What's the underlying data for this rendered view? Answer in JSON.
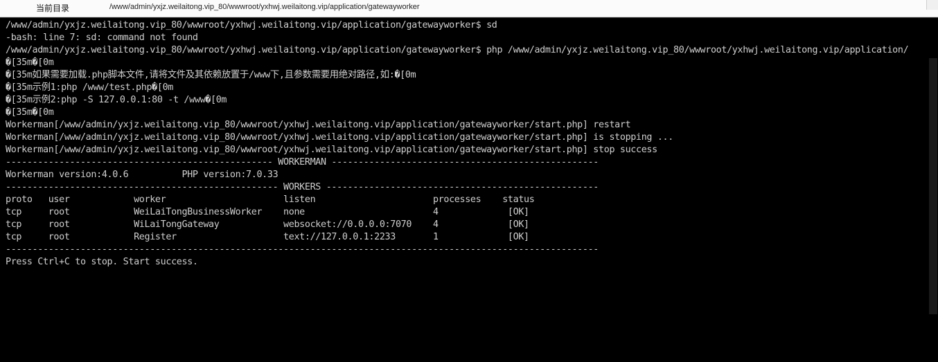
{
  "location_bar": {
    "label": "当前目录",
    "path": "/www/admin/yxjz.weilaitong.vip_80/wwwroot/yxhwj.weilaitong.vip/application/gatewayworker"
  },
  "terminal": {
    "lines": [
      "/www/admin/yxjz.weilaitong.vip_80/wwwroot/yxhwj.weilaitong.vip/application/gatewayworker$ sd",
      "-bash: line 7: sd: command not found",
      "/www/admin/yxjz.weilaitong.vip_80/wwwroot/yxhwj.weilaitong.vip/application/gatewayworker$ php /www/admin/yxjz.weilaitong.vip_80/wwwroot/yxhwj.weilaitong.vip/application/",
      "�[35m�[0m",
      "�[35m如果需要加载.php脚本文件,请将文件及其依赖放置于/www下,且参数需要用绝对路径,如:�[0m",
      "�[35m示例1:php /www/test.php�[0m",
      "�[35m示例2:php -S 127.0.0.1:80 -t /www�[0m",
      "�[35m�[0m",
      "Workerman[/www/admin/yxjz.weilaitong.vip_80/wwwroot/yxhwj.weilaitong.vip/application/gatewayworker/start.php] restart",
      "Workerman[/www/admin/yxjz.weilaitong.vip_80/wwwroot/yxhwj.weilaitong.vip/application/gatewayworker/start.php] is stopping ...",
      "Workerman[/www/admin/yxjz.weilaitong.vip_80/wwwroot/yxhwj.weilaitong.vip/application/gatewayworker/start.php] stop success",
      "-------------------------------------------------- WORKERMAN --------------------------------------------------",
      "Workerman version:4.0.6          PHP version:7.0.33",
      "--------------------------------------------------- WORKERS ---------------------------------------------------",
      "proto   user            worker                      listen                      processes    status",
      "tcp     root            WeiLaiTongBusinessWorker    none                        4             [OK]",
      "tcp     root            WiLaiTongGateway            websocket://0.0.0.0:7070    4             [OK]",
      "tcp     root            Register                    text://127.0.0.1:2233       1             [OK]",
      "---------------------------------------------------------------------------------------------------------------",
      "Press Ctrl+C to stop. Start success."
    ]
  }
}
